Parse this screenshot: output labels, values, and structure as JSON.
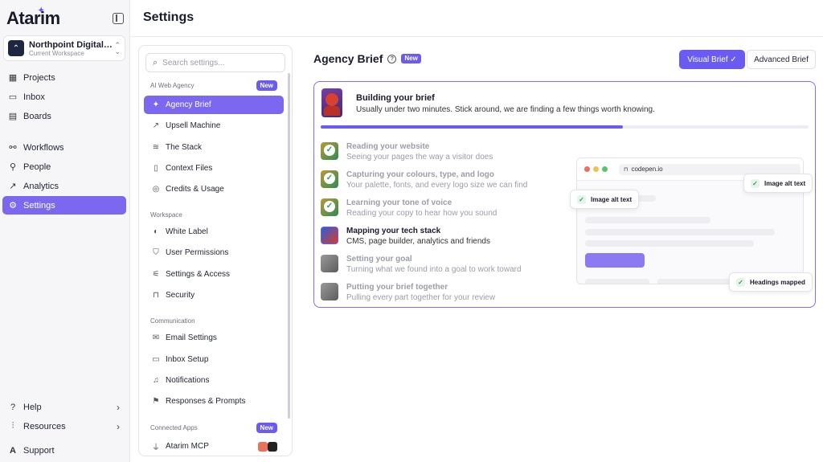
{
  "app": {
    "logo": "Atarim",
    "workspace": {
      "name": "Northpoint Digital Ag...",
      "subtitle": "Current Workspace"
    }
  },
  "nav": {
    "main": [
      {
        "label": "Projects",
        "icon": "grid-icon"
      },
      {
        "label": "Inbox",
        "icon": "inbox-icon"
      },
      {
        "label": "Boards",
        "icon": "board-icon"
      }
    ],
    "secondary": [
      {
        "label": "Workflows",
        "icon": "workflow-icon"
      },
      {
        "label": "People",
        "icon": "person-icon"
      },
      {
        "label": "Analytics",
        "icon": "chart-icon"
      },
      {
        "label": "Settings",
        "icon": "gear-icon",
        "active": true
      }
    ],
    "bottom": [
      {
        "label": "Help",
        "icon": "help-icon"
      },
      {
        "label": "Resources",
        "icon": "bars-icon"
      },
      {
        "label": "Support",
        "icon": "atarim-logo-icon"
      }
    ]
  },
  "header": {
    "title": "Settings"
  },
  "settings_panel": {
    "search_placeholder": "Search settings...",
    "groups": [
      {
        "label": "AI Web Agency",
        "badge": "New",
        "items": [
          "Agency Brief",
          "Upsell Machine",
          "The Stack",
          "Context Files",
          "Credits & Usage"
        ]
      },
      {
        "label": "Workspace",
        "items": [
          "White Label",
          "User Permissions",
          "Settings & Access",
          "Security"
        ]
      },
      {
        "label": "Communication",
        "items": [
          "Email Settings",
          "Inbox Setup",
          "Notifications",
          "Responses & Prompts"
        ]
      },
      {
        "label": "Connected Apps",
        "badge": "New",
        "items": [
          "Atarim MCP"
        ]
      }
    ],
    "active_item": "Agency Brief"
  },
  "brief": {
    "title": "Agency Brief",
    "badge": "New",
    "visual_button": "Visual Brief",
    "advanced_button": "Advanced Brief",
    "card_title": "Building your brief",
    "card_subtitle": "Usually under two minutes. Stick around, we are finding a few things worth knowing.",
    "progress": 0.62,
    "steps": [
      {
        "title": "Reading your website",
        "desc": "Seeing your pages the way a visitor does",
        "state": "done"
      },
      {
        "title": "Capturing your colours, type, and logo",
        "desc": "Your palette, fonts, and every logo size we can find",
        "state": "done"
      },
      {
        "title": "Learning your tone of voice",
        "desc": "Reading your copy to hear how you sound",
        "state": "done"
      },
      {
        "title": "Mapping your tech stack",
        "desc": "CMS, page builder, analytics and friends",
        "state": "current"
      },
      {
        "title": "Setting your goal",
        "desc": "Turning what we found into a goal to work toward",
        "state": "pending"
      },
      {
        "title": "Putting your brief together",
        "desc": "Pulling every part together for your review",
        "state": "pending"
      }
    ],
    "preview": {
      "url": "codepen.io",
      "chips": [
        "Image alt text",
        "Image alt text",
        "Headings mapped"
      ]
    }
  },
  "colors": {
    "accent": "#6b5bf2",
    "nav_active": "#7c68f0",
    "success": "#2f9e55"
  }
}
